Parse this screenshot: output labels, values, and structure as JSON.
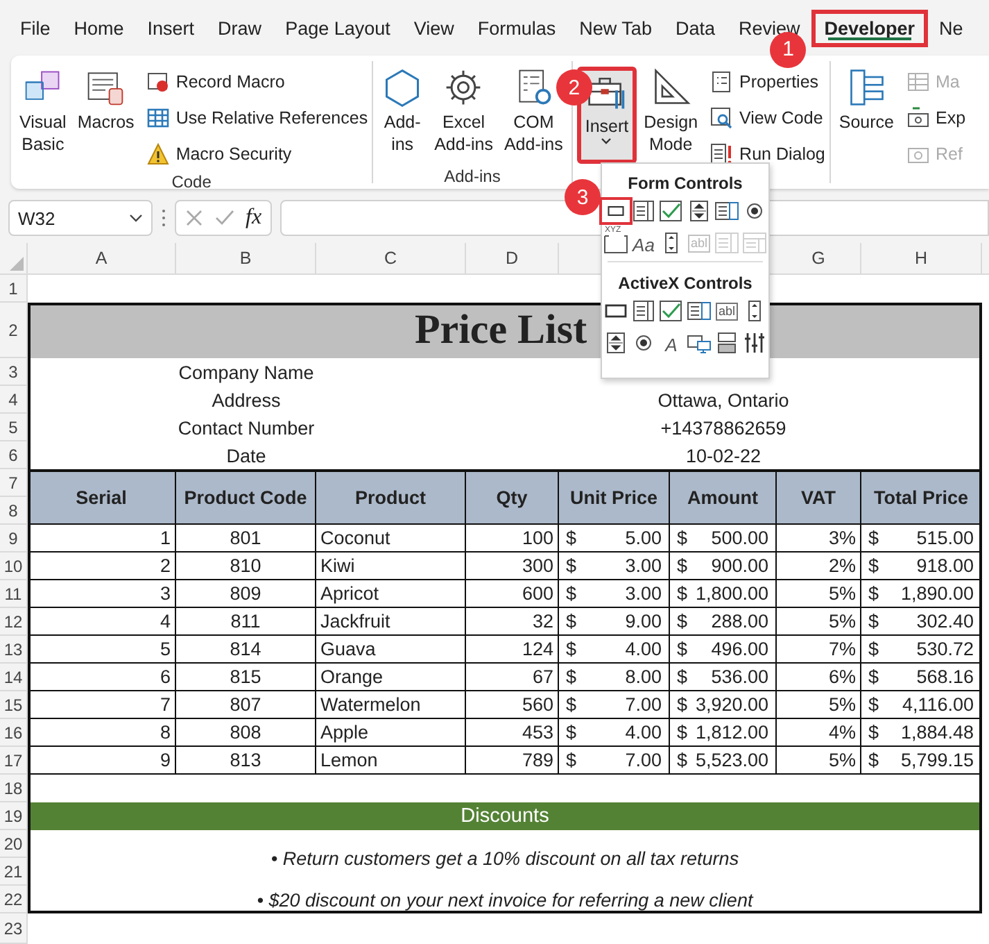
{
  "menu_tabs": [
    {
      "label": "File",
      "selected": false
    },
    {
      "label": "Home",
      "selected": false
    },
    {
      "label": "Insert",
      "selected": false
    },
    {
      "label": "Draw",
      "selected": false
    },
    {
      "label": "Page Layout",
      "selected": false
    },
    {
      "label": "View",
      "selected": false
    },
    {
      "label": "Formulas",
      "selected": false
    },
    {
      "label": "New Tab",
      "selected": false
    },
    {
      "label": "Data",
      "selected": false
    },
    {
      "label": "Review",
      "selected": false
    },
    {
      "label": "Developer",
      "selected": true,
      "badge": "1"
    },
    {
      "label": "Ne",
      "selected": false
    }
  ],
  "ribbon": {
    "groups": [
      {
        "label": "Code",
        "large": [
          {
            "lines": [
              "Visual",
              "Basic"
            ],
            "pressed": false,
            "menu": false
          },
          {
            "lines": [
              "Macros"
            ],
            "pressed": false,
            "menu": false
          }
        ],
        "small": [
          {
            "label": "Record Macro",
            "disabled": false
          },
          {
            "label": "Use Relative References",
            "disabled": false
          },
          {
            "label": "Macro Security",
            "disabled": false
          }
        ]
      },
      {
        "label": "Add-ins",
        "large": [
          {
            "lines": [
              "Add-",
              "ins"
            ],
            "pressed": false,
            "menu": false
          },
          {
            "lines": [
              "Excel",
              "Add-ins"
            ],
            "pressed": false,
            "menu": false
          },
          {
            "lines": [
              "COM",
              "Add-ins"
            ],
            "pressed": false,
            "menu": false
          }
        ]
      },
      {
        "large": [
          {
            "lines": [
              "Insert"
            ],
            "pressed": true,
            "menu": true,
            "badge": "2"
          },
          {
            "lines": [
              "Design",
              "Mode"
            ],
            "pressed": false,
            "menu": false
          }
        ],
        "small": [
          {
            "label": "Properties",
            "disabled": false
          },
          {
            "label": "View Code",
            "disabled": false
          },
          {
            "label": "Run Dialog",
            "disabled": false
          }
        ]
      },
      {
        "large": [
          {
            "lines": [
              "Source"
            ],
            "pressed": false,
            "menu": false
          }
        ],
        "small": [
          {
            "label": "Ma",
            "disabled": true
          },
          {
            "label": "Exp",
            "disabled": false
          },
          {
            "label": "Ref",
            "disabled": true
          }
        ]
      }
    ]
  },
  "insert_menu": {
    "sections": [
      {
        "title": "Form Controls",
        "controls": [
          {
            "disabled": false,
            "badge": "3"
          },
          {
            "disabled": false
          },
          {
            "disabled": false
          },
          {
            "disabled": false
          },
          {
            "disabled": false
          },
          {
            "disabled": false
          },
          {
            "disabled": false,
            "glyph": "XYZ"
          },
          {
            "disabled": false,
            "glyph": "Aa"
          },
          {
            "disabled": false
          },
          {
            "disabled": true,
            "glyph": "abl"
          },
          {
            "disabled": true
          },
          {
            "disabled": true
          }
        ]
      },
      {
        "title": "ActiveX Controls",
        "controls": [
          {
            "disabled": false
          },
          {
            "disabled": false
          },
          {
            "disabled": false
          },
          {
            "disabled": false
          },
          {
            "disabled": false,
            "glyph": "abl"
          },
          {
            "disabled": false
          },
          {
            "disabled": false
          },
          {
            "disabled": false
          },
          {
            "disabled": false,
            "glyph": "A"
          },
          {
            "disabled": false
          },
          {
            "disabled": false
          },
          {
            "disabled": false
          }
        ]
      }
    ]
  },
  "formula_bar": {
    "name_box": "W32",
    "fx": "fx"
  },
  "columns": [
    "A",
    "B",
    "C",
    "D",
    "G",
    "H"
  ],
  "row_numbers": [
    "1",
    "2",
    "3",
    "4",
    "5",
    "6",
    "7",
    "8",
    "9",
    "10",
    "11",
    "12",
    "13",
    "14",
    "15",
    "16",
    "17",
    "18",
    "19",
    "20",
    "21",
    "22",
    "23"
  ],
  "sheet": {
    "title": "Price List",
    "info": [
      {
        "label": "Company Name"
      },
      {
        "label": "Address",
        "value": "Ottawa, Ontario"
      },
      {
        "label": "Contact Number",
        "value": "+14378862659"
      },
      {
        "label": "Date",
        "value": "10-02-22"
      }
    ],
    "table": {
      "columns": [
        "Serial",
        "Product Code",
        "Product",
        "Qty",
        "Unit Price",
        "Amount",
        "VAT",
        "Total Price"
      ],
      "rows": [
        {
          "serial": "1",
          "code": "801",
          "product": "Coconut",
          "qty": "100",
          "unit_price": {
            "currency": "$",
            "value": "5.00"
          },
          "amount": {
            "currency": "$",
            "value": "500.00"
          },
          "vat": "3%",
          "total": {
            "currency": "$",
            "value": "515.00"
          }
        },
        {
          "serial": "2",
          "code": "810",
          "product": "Kiwi",
          "qty": "300",
          "unit_price": {
            "currency": "$",
            "value": "3.00"
          },
          "amount": {
            "currency": "$",
            "value": "900.00"
          },
          "vat": "2%",
          "total": {
            "currency": "$",
            "value": "918.00"
          }
        },
        {
          "serial": "3",
          "code": "809",
          "product": "Apricot",
          "qty": "600",
          "unit_price": {
            "currency": "$",
            "value": "3.00"
          },
          "amount": {
            "currency": "$",
            "value": "1,800.00"
          },
          "vat": "5%",
          "total": {
            "currency": "$",
            "value": "1,890.00"
          }
        },
        {
          "serial": "4",
          "code": "811",
          "product": "Jackfruit",
          "qty": "32",
          "unit_price": {
            "currency": "$",
            "value": "9.00"
          },
          "amount": {
            "currency": "$",
            "value": "288.00"
          },
          "vat": "5%",
          "total": {
            "currency": "$",
            "value": "302.40"
          }
        },
        {
          "serial": "5",
          "code": "814",
          "product": "Guava",
          "qty": "124",
          "unit_price": {
            "currency": "$",
            "value": "4.00"
          },
          "amount": {
            "currency": "$",
            "value": "496.00"
          },
          "vat": "7%",
          "total": {
            "currency": "$",
            "value": "530.72"
          }
        },
        {
          "serial": "6",
          "code": "815",
          "product": "Orange",
          "qty": "67",
          "unit_price": {
            "currency": "$",
            "value": "8.00"
          },
          "amount": {
            "currency": "$",
            "value": "536.00"
          },
          "vat": "6%",
          "total": {
            "currency": "$",
            "value": "568.16"
          }
        },
        {
          "serial": "7",
          "code": "807",
          "product": "Watermelon",
          "qty": "560",
          "unit_price": {
            "currency": "$",
            "value": "7.00"
          },
          "amount": {
            "currency": "$",
            "value": "3,920.00"
          },
          "vat": "5%",
          "total": {
            "currency": "$",
            "value": "4,116.00"
          }
        },
        {
          "serial": "8",
          "code": "808",
          "product": "Apple",
          "qty": "453",
          "unit_price": {
            "currency": "$",
            "value": "4.00"
          },
          "amount": {
            "currency": "$",
            "value": "1,812.00"
          },
          "vat": "4%",
          "total": {
            "currency": "$",
            "value": "1,884.48"
          }
        },
        {
          "serial": "9",
          "code": "813",
          "product": "Lemon",
          "qty": "789",
          "unit_price": {
            "currency": "$",
            "value": "7.00"
          },
          "amount": {
            "currency": "$",
            "value": "5,523.00"
          },
          "vat": "5%",
          "total": {
            "currency": "$",
            "value": "5,799.15"
          }
        }
      ]
    },
    "discounts": {
      "title": "Discounts",
      "items": [
        "• Return customers get a 10% discount on all tax returns",
        "• $20 discount on your next invoice for referring a new client"
      ]
    }
  }
}
